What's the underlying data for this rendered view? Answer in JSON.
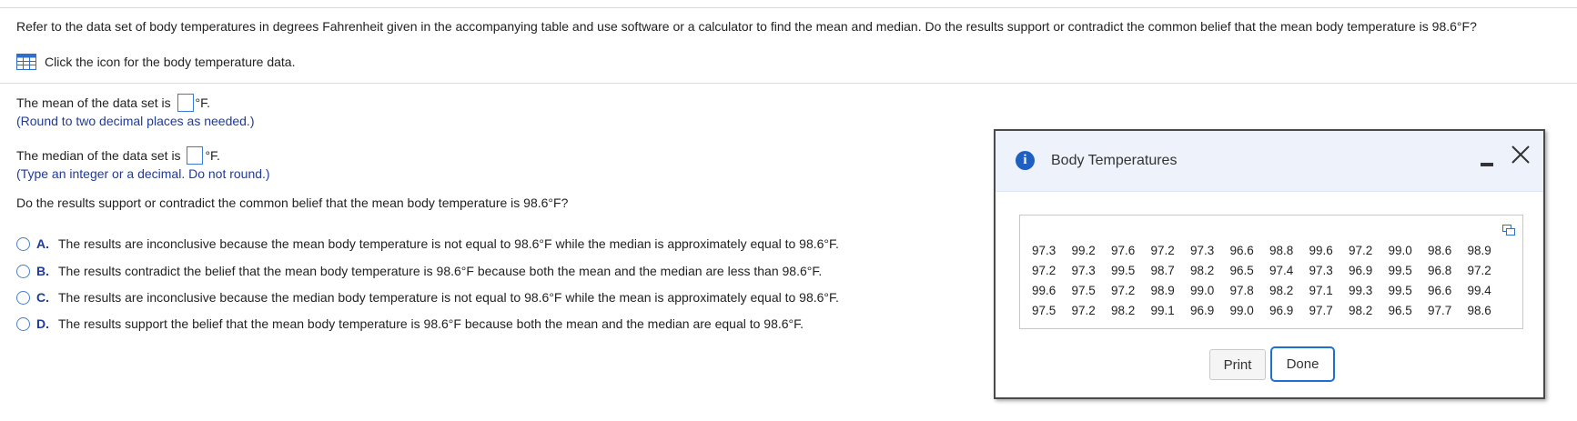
{
  "question": {
    "text": "Refer to the data set of body temperatures in degrees Fahrenheit given in the accompanying table and use software or a calculator to find the mean and median. Do the results support or contradict the common belief that the mean body temperature is 98.6°F?",
    "data_link": "Click the icon for the body temperature data."
  },
  "mean": {
    "prefix": "The mean of the data set is",
    "suffix": "°F.",
    "value": "",
    "hint": "(Round to two decimal places as needed.)"
  },
  "median": {
    "prefix": "The median of the data set is",
    "suffix": "°F.",
    "value": "",
    "hint": "(Type an integer or a decimal. Do not round.)"
  },
  "support_question": "Do the results support or contradict the common belief that the mean body temperature is 98.6°F?",
  "options": [
    {
      "letter": "A.",
      "text": "The results are inconclusive because the mean body temperature is not equal to 98.6°F while the median is approximately equal to 98.6°F."
    },
    {
      "letter": "B.",
      "text": "The results contradict the belief that the mean body temperature is 98.6°F because both the mean and the median are less than 98.6°F."
    },
    {
      "letter": "C.",
      "text": "The results are inconclusive because the median body temperature is not equal to 98.6°F while the mean is approximately equal to 98.6°F."
    },
    {
      "letter": "D.",
      "text": "The results support the belief that the mean body temperature is 98.6°F because both the mean and the median are equal to 98.6°F."
    }
  ],
  "dialog": {
    "title": "Body Temperatures",
    "rows": [
      [
        "97.3",
        "99.2",
        "97.6",
        "97.2",
        "97.3",
        "96.6",
        "98.8",
        "99.6",
        "97.2",
        "99.0",
        "98.6",
        "98.9"
      ],
      [
        "97.2",
        "97.3",
        "99.5",
        "98.7",
        "98.2",
        "96.5",
        "97.4",
        "97.3",
        "96.9",
        "99.5",
        "96.8",
        "97.2"
      ],
      [
        "99.6",
        "97.5",
        "97.2",
        "98.9",
        "99.0",
        "97.8",
        "98.2",
        "97.1",
        "99.3",
        "99.5",
        "96.6",
        "99.4"
      ],
      [
        "97.5",
        "97.2",
        "98.2",
        "99.1",
        "96.9",
        "99.0",
        "96.9",
        "97.7",
        "98.2",
        "96.5",
        "97.7",
        "98.6"
      ]
    ],
    "print_label": "Print",
    "done_label": "Done"
  },
  "colors": {
    "accent": "#1f6fd1",
    "hint": "#1f3a9a",
    "header_bg": "#eef3fb"
  }
}
